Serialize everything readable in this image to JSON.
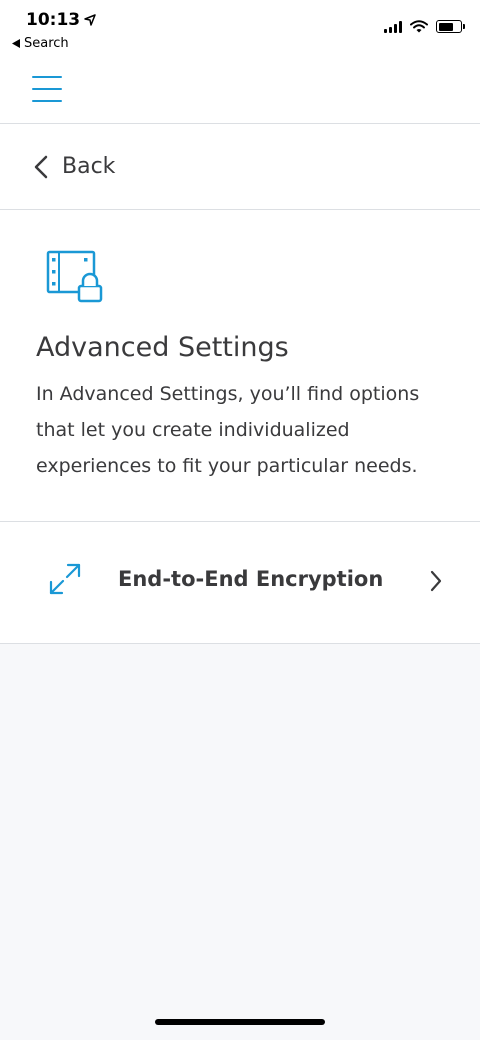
{
  "status_bar": {
    "time": "10:13",
    "back_app": "Search",
    "battery_level": 0.7
  },
  "nav": {
    "back_label": "Back"
  },
  "intro": {
    "icon": "video-lock-icon",
    "title": "Advanced Settings",
    "description": "In Advanced Settings, you’ll find options that let you create individualized experiences to fit your particular needs."
  },
  "settings": [
    {
      "icon": "expand-arrows-icon",
      "label": "End-to-End Encryption"
    }
  ],
  "colors": {
    "accent": "#1a98d5",
    "text": "#3a3a3c",
    "divider": "#dcdfe3",
    "background_secondary": "#f7f8fa"
  }
}
